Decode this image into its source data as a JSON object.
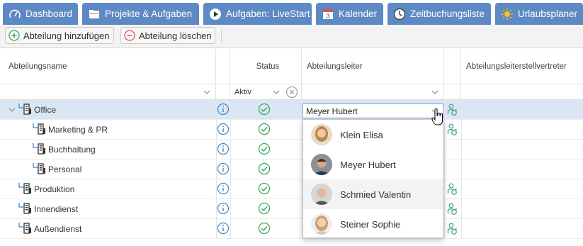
{
  "tabs": [
    {
      "label": "Dashboard",
      "icon": "dashboard-icon"
    },
    {
      "label": "Projekte & Aufgaben",
      "icon": "folder-icon"
    },
    {
      "label": "Aufgaben: LiveStart",
      "icon": "play-icon"
    },
    {
      "label": "Kalender",
      "icon": "calendar-icon",
      "day": "3"
    },
    {
      "label": "Zeitbuchungsliste",
      "icon": "clock-icon"
    },
    {
      "label": "Urlaubsplaner",
      "icon": "sun-icon"
    }
  ],
  "toolbar": {
    "add_label": "Abteilung hinzufügen",
    "delete_label": "Abteilung löschen"
  },
  "columns": {
    "name": "Abteilungsname",
    "status": "Status",
    "head": "Abteilungsleiter",
    "deputy": "Abteilungsleiterstellvertreter"
  },
  "filters": {
    "status_value": "Aktiv"
  },
  "rows": [
    {
      "name": "Office",
      "level": 0,
      "expanded": true,
      "selected": true
    },
    {
      "name": "Marketing & PR",
      "level": 1
    },
    {
      "name": "Buchhaltung",
      "level": 1
    },
    {
      "name": "Personal",
      "level": 1
    },
    {
      "name": "Produktion",
      "level": 0
    },
    {
      "name": "Innendienst",
      "level": 0
    },
    {
      "name": "Außendienst",
      "level": 0
    }
  ],
  "edit": {
    "value": "Meyer Hubert"
  },
  "dropdown": {
    "options": [
      {
        "label": "Klein Elisa"
      },
      {
        "label": "Meyer Hubert"
      },
      {
        "label": "Schmied Valentin"
      },
      {
        "label": "Steiner Sophie"
      }
    ],
    "highlighted_index": 2
  },
  "colors": {
    "tab_bg": "#5d89c4",
    "accent_green": "#3aa65b",
    "info_blue": "#3d87c9",
    "selection": "#dbe6f4",
    "delete_red": "#d9534f"
  }
}
